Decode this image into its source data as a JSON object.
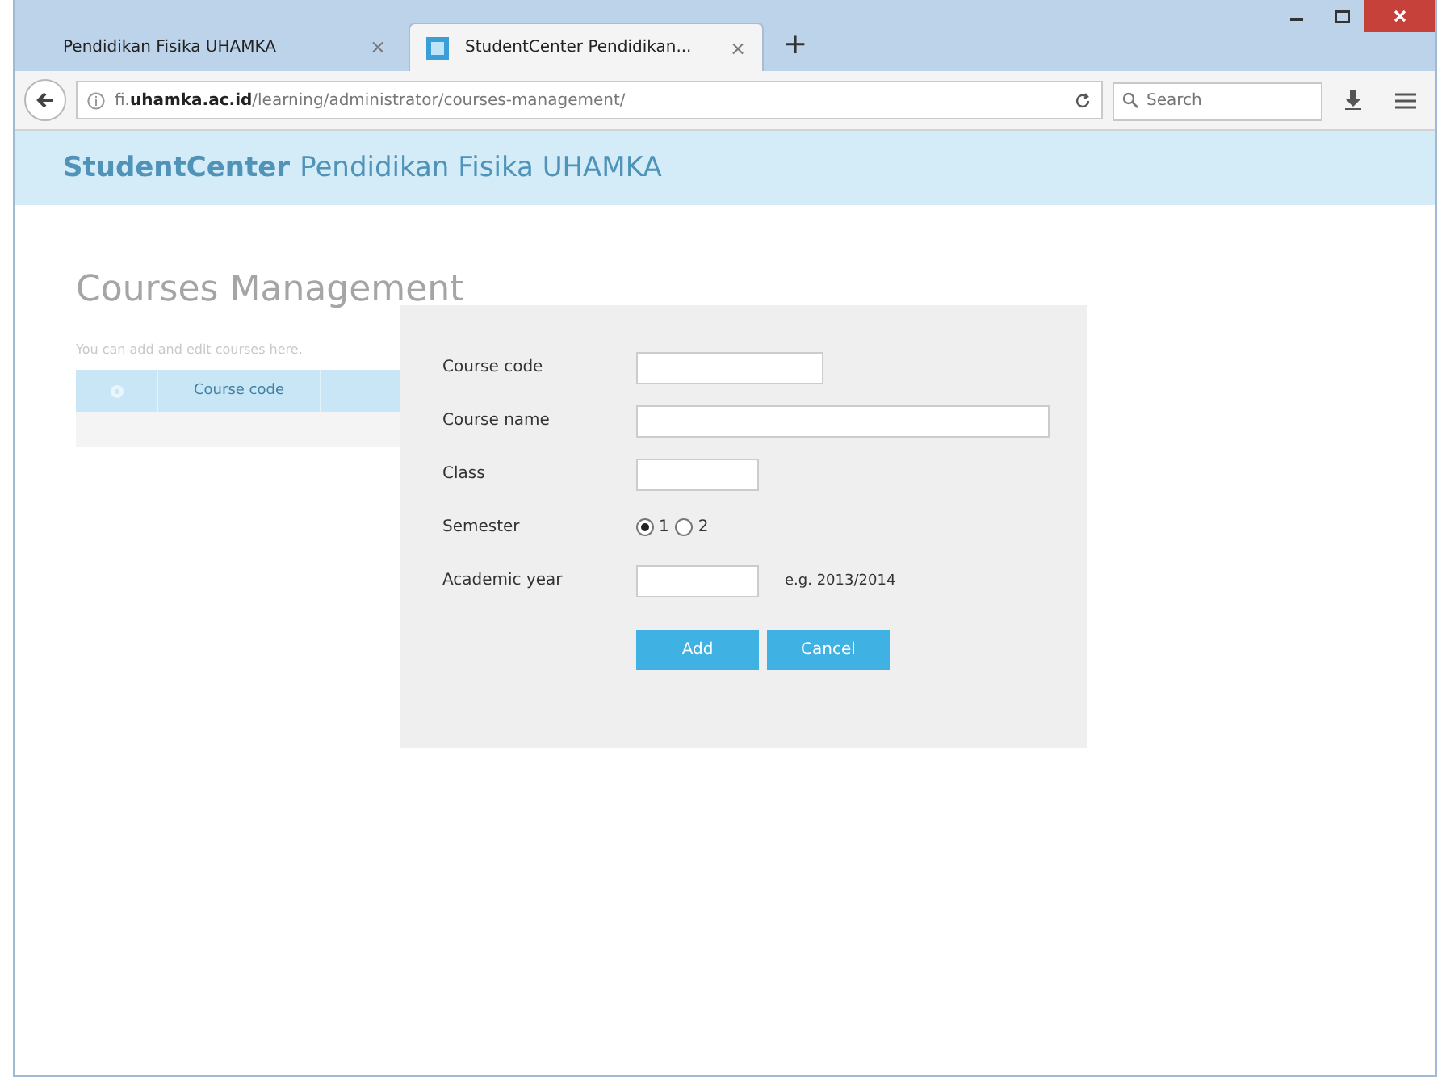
{
  "browser": {
    "tabs": [
      {
        "title": "Pendidikan Fisika UHAMKA",
        "close": "×",
        "selected": false
      },
      {
        "title": "StudentCenter Pendidikan...",
        "close": "×",
        "selected": true
      }
    ],
    "new_tab": "+",
    "url": "fi.**uhamka.ac.id**/learning/administrator/courses-management/",
    "search": {
      "placeholder": "Search"
    }
  },
  "site_header": {
    "brand": "StudentCenter",
    "title": "Pendidikan Fisika UHAMKA"
  },
  "page": {
    "heading": "Courses Management",
    "intro": "You can add and edit courses here.",
    "table": {
      "columns": [
        "Course code"
      ]
    }
  },
  "dialog": {
    "fields": [
      {
        "kind": "text",
        "label": "Course code"
      },
      {
        "kind": "text",
        "label": "Course name"
      },
      {
        "kind": "text",
        "label": "Class"
      },
      {
        "kind": "radio",
        "label": "Semester",
        "options": [
          {
            "label": "1",
            "selected": true
          },
          {
            "label": "2",
            "selected": false
          }
        ]
      },
      {
        "kind": "text",
        "label": "Academic year",
        "hint": "e.g. 2013/2014"
      }
    ],
    "buttons": [
      "Add",
      "Cancel"
    ]
  }
}
